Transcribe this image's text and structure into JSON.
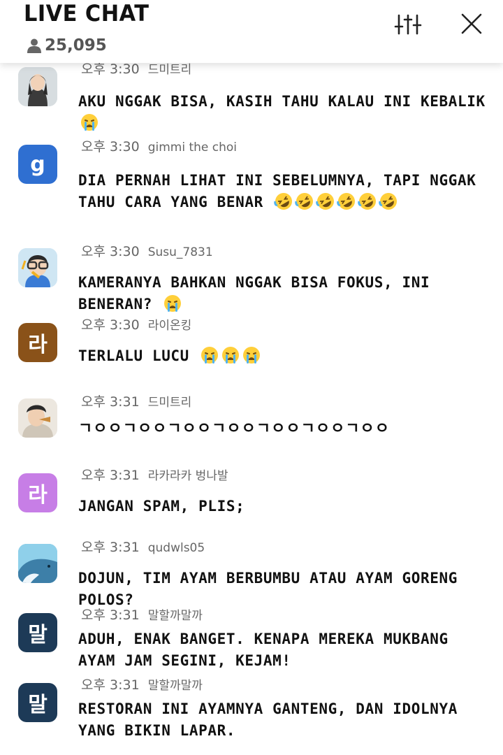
{
  "header": {
    "title": "LIVE CHAT",
    "viewer_count": "25,095"
  },
  "messages": [
    {
      "time": "오후 3:30",
      "user": "드미트리",
      "text": "AKU NGGAK BISA, KASIH TAHU KALAU INI KEBALIK",
      "emoji": [
        "crying-face"
      ]
    },
    {
      "time": "오후 3:30",
      "user": "gimmi the choi",
      "text": "DIA PERNAH LIHAT INI SEBELUMNYA, TAPI NGGAK TAHU CARA YANG BENAR",
      "emoji": [
        "rofl-face",
        "rofl-face",
        "rofl-face",
        "rofl-face",
        "rofl-face",
        "rofl-face"
      ],
      "avatar_letter": "g",
      "avatar_color": "#2f6fd1"
    },
    {
      "time": "오후 3:30",
      "user": "Susu_7831",
      "text": "KAMERANYA BAHKAN NGGAK BISA FOKUS, INI BENERAN?",
      "emoji": [
        "crying-face"
      ]
    },
    {
      "time": "오후 3:30",
      "user": "라이온킹",
      "text": "TERLALU LUCU",
      "emoji": [
        "crying-face",
        "crying-face",
        "crying-face"
      ],
      "avatar_letter": "라",
      "avatar_color": "#8a5219"
    },
    {
      "time": "오후 3:31",
      "user": "드미트리",
      "text": "ㄱㅇㅇㄱㅇㅇㄱㅇㅇㄱㅇㅇㄱㅇㅇㄱㅇㅇㄱㅇㅇ",
      "emoji": []
    },
    {
      "time": "오후 3:31",
      "user": "라카라카 벙나발",
      "text": "JANGAN SPAM, PLIS;",
      "emoji": [],
      "avatar_letter": "라",
      "avatar_color": "#c77ee6"
    },
    {
      "time": "오후 3:31",
      "user": "qudwls05",
      "text": "DOJUN, TIM AYAM BERBUMBU ATAU AYAM GORENG POLOS?",
      "emoji": []
    },
    {
      "time": "오후 3:31",
      "user": "말할까말까",
      "text": "ADUH, ENAK BANGET. KENAPA MEREKA MUKBANG AYAM JAM SEGINI, KEJAM!",
      "emoji": [],
      "avatar_letter": "말",
      "avatar_color": "#1d3a57"
    },
    {
      "time": "오후 3:31",
      "user": "말할까말까",
      "text": "RESTORAN INI AYAMNYA GANTENG, DAN IDOLNYA YANG BIKIN LAPAR.",
      "emoji": [],
      "avatar_letter": "말",
      "avatar_color": "#1d3a57"
    }
  ]
}
